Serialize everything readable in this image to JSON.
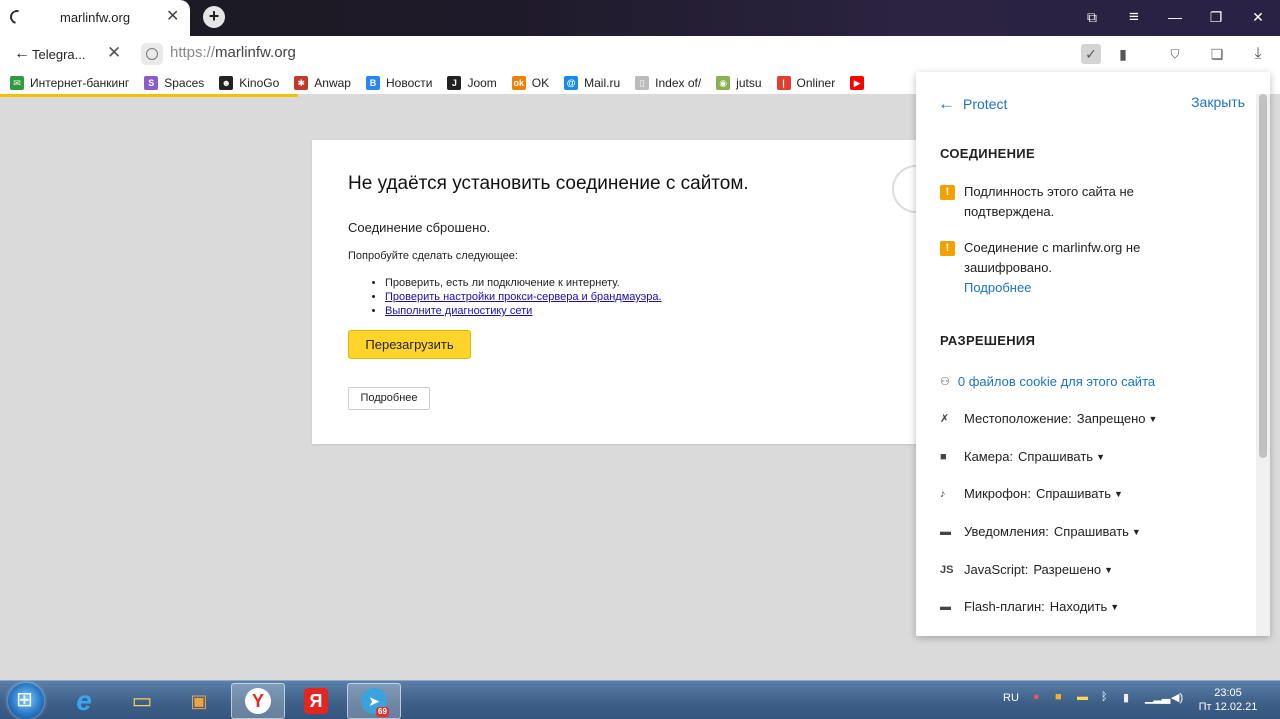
{
  "tab": {
    "title": "marlinfw.org",
    "close": "✕",
    "new_tab": "+"
  },
  "window_controls": [
    "⧉",
    "≡",
    "—",
    "❐",
    "✕"
  ],
  "omnibox": {
    "back_tab_label": "Telegra...",
    "scheme": "https://",
    "host": "marlinfw.org"
  },
  "bookmarks": [
    {
      "label": "Интернет-банкинг",
      "icon": "bank-icon",
      "color": "#2e9b3c",
      "glyph": "✉"
    },
    {
      "label": "Spaces",
      "icon": "spaces-icon",
      "color": "#8a5cc7",
      "glyph": "S"
    },
    {
      "label": "KinoGo",
      "icon": "kinogo-icon",
      "color": "#222222",
      "glyph": "☻"
    },
    {
      "label": "Anwap",
      "icon": "anwap-icon",
      "color": "#c0392b",
      "glyph": "✱"
    },
    {
      "label": "Новости",
      "icon": "vk-icon",
      "color": "#2787f5",
      "glyph": "В"
    },
    {
      "label": "Joom",
      "icon": "joom-icon",
      "color": "#222222",
      "glyph": "J"
    },
    {
      "label": "OK",
      "icon": "ok-icon",
      "color": "#ee8208",
      "glyph": "ok"
    },
    {
      "label": "Mail.ru",
      "icon": "mailru-icon",
      "color": "#168de2",
      "glyph": "@"
    },
    {
      "label": "Index of/",
      "icon": "file-icon",
      "color": "#bbbbbb",
      "glyph": "▯"
    },
    {
      "label": "jutsu",
      "icon": "jutsu-icon",
      "color": "#8ab04f",
      "glyph": "◉"
    },
    {
      "label": "Onliner",
      "icon": "onliner-icon",
      "color": "#e33d2d",
      "glyph": "|"
    },
    {
      "label": "",
      "icon": "youtube-icon",
      "color": "#ff0000",
      "glyph": "▶"
    }
  ],
  "error": {
    "title": "Не удаётся установить соединение с сайтом.",
    "reason": "Соединение сброшено.",
    "try_label": "Попробуйте сделать следующее:",
    "suggestions": [
      "Проверить, есть ли подключение к интернету.",
      "Проверить настройки прокси-сервера и брандмауэра.",
      "Выполните диагностику сети"
    ],
    "reload_button": "Перезагрузить",
    "more_button": "Подробнее"
  },
  "protect": {
    "back_label": "Protect",
    "close_label": "Закрыть",
    "connection_heading": "СОЕДИНЕНИЕ",
    "warnings": [
      "Подлинность этого сайта не подтверждена.",
      "Соединение с marlinfw.org не зашифровано."
    ],
    "details_link": "Подробнее",
    "permissions_heading": "РАЗРЕШЕНИЯ",
    "cookies": "0 файлов cookie для этого сайта",
    "permissions": [
      {
        "label": "Местоположение:",
        "value": "Запрещено",
        "icon": "location-off-icon",
        "glyph": "✗"
      },
      {
        "label": "Камера:",
        "value": "Спрашивать",
        "icon": "camera-icon",
        "glyph": "■"
      },
      {
        "label": "Микрофон:",
        "value": "Спрашивать",
        "icon": "microphone-icon",
        "glyph": "♪"
      },
      {
        "label": "Уведомления:",
        "value": "Спрашивать",
        "icon": "notification-icon",
        "glyph": "▬"
      },
      {
        "label": "JavaScript:",
        "value": "Разрешено",
        "icon": "javascript-icon",
        "glyph": "JS"
      },
      {
        "label": "Flash-плагин:",
        "value": "Находить",
        "icon": "flash-plugin-icon",
        "glyph": "▬"
      }
    ]
  },
  "taskbar": {
    "language": "RU",
    "telegram_badge": "69",
    "time": "23:05",
    "date": "Пт 12.02.21"
  }
}
